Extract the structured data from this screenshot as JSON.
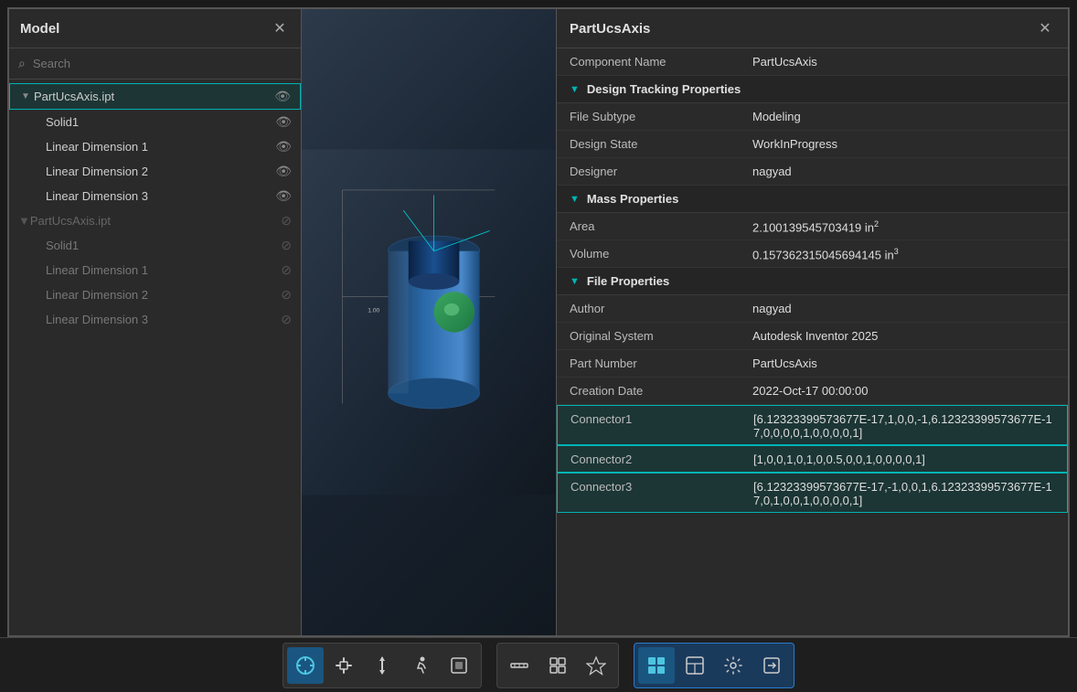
{
  "leftPanel": {
    "title": "Model",
    "search": {
      "placeholder": "Search"
    },
    "tree": {
      "group1": {
        "name": "PartUcsAxis.ipt",
        "active": true,
        "visible": true,
        "children": [
          {
            "name": "Solid1",
            "visible": true
          },
          {
            "name": "Linear Dimension 1",
            "visible": true
          },
          {
            "name": "Linear Dimension 2",
            "visible": true
          },
          {
            "name": "Linear Dimension 3",
            "visible": true
          }
        ]
      },
      "group2": {
        "name": "PartUcsAxis.ipt",
        "dimmed": true,
        "visible": false,
        "children": [
          {
            "name": "Solid1",
            "dimmed": true,
            "visible": false
          },
          {
            "name": "Linear Dimension 1",
            "dimmed": true,
            "visible": false
          },
          {
            "name": "Linear Dimension 2",
            "dimmed": true,
            "visible": false
          },
          {
            "name": "Linear Dimension 3",
            "dimmed": true,
            "visible": false
          }
        ]
      }
    }
  },
  "rightPanel": {
    "title": "PartUcsAxis",
    "sections": [
      {
        "type": "row",
        "key": "Component Name",
        "value": "PartUcsAxis"
      },
      {
        "type": "section",
        "title": "Design Tracking Properties"
      },
      {
        "type": "row",
        "key": "File Subtype",
        "value": "Modeling"
      },
      {
        "type": "row",
        "key": "Design State",
        "value": "WorkInProgress"
      },
      {
        "type": "row",
        "key": "Designer",
        "value": "nagyad"
      },
      {
        "type": "section",
        "title": "Mass Properties"
      },
      {
        "type": "row",
        "key": "Area",
        "value": "2.100139545703419 in²"
      },
      {
        "type": "row",
        "key": "Volume",
        "value": "0.157362315045694145 in³"
      },
      {
        "type": "section",
        "title": "File Properties"
      },
      {
        "type": "row",
        "key": "Author",
        "value": "nagyad"
      },
      {
        "type": "row",
        "key": "Original System",
        "value": "Autodesk Inventor 2025"
      },
      {
        "type": "row",
        "key": "Part Number",
        "value": "PartUcsAxis"
      },
      {
        "type": "row",
        "key": "Creation Date",
        "value": "2022-Oct-17 00:00:00"
      },
      {
        "type": "row",
        "key": "Connector1",
        "value": "[6.12323399573677E-17,1,0,0,-1,6.12323399573677E-17,0,0,0,0,1,0,0,0,0,1]",
        "highlighted": true
      },
      {
        "type": "row",
        "key": "Connector2",
        "value": "[1,0,0,1,0,1,0,0.5,0,0,1,0,0,0,0,1]",
        "highlighted": true
      },
      {
        "type": "row",
        "key": "Connector3",
        "value": "[6.12323399573677E-17,-1,0,0,1,6.12323399573677E-17,0,1,0,0,1,0,0,0,0,1]",
        "highlighted": true
      }
    ]
  },
  "toolbar": {
    "groups": [
      {
        "buttons": [
          {
            "icon": "⊕",
            "name": "select-tool",
            "active": true
          },
          {
            "icon": "✋",
            "name": "pan-tool"
          },
          {
            "icon": "↕",
            "name": "move-tool"
          },
          {
            "icon": "🚶",
            "name": "walk-tool"
          },
          {
            "icon": "⬜",
            "name": "snap-tool"
          }
        ]
      },
      {
        "buttons": [
          {
            "icon": "📏",
            "name": "measure-tool"
          },
          {
            "icon": "📦",
            "name": "component-tool"
          },
          {
            "icon": "◈",
            "name": "explode-tool"
          }
        ]
      },
      {
        "buttons": [
          {
            "icon": "⊞",
            "name": "grid-tool",
            "active": true
          },
          {
            "icon": "⊟",
            "name": "layout-tool"
          },
          {
            "icon": "⚙",
            "name": "settings-tool"
          },
          {
            "icon": "⬡",
            "name": "export-tool"
          }
        ]
      }
    ]
  }
}
